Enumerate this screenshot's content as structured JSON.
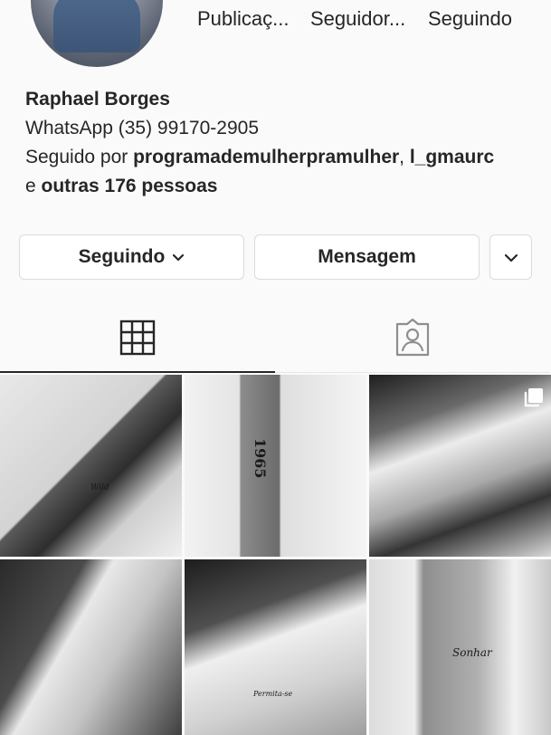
{
  "profile": {
    "stats": [
      {
        "label": "Publicaç..."
      },
      {
        "label": "Seguidor..."
      },
      {
        "label": "Seguindo"
      }
    ],
    "name": "Raphael Borges",
    "bio_line": "WhatsApp (35) 99170-2905",
    "followed_by_prefix": "Seguido por ",
    "followed_by_user1": "programademulherpramulher",
    "followed_by_sep": ", ",
    "followed_by_user2": "l_gmaurc",
    "followed_by_and": "e ",
    "followed_by_others": "outras 176 pessoas"
  },
  "actions": {
    "following_label": "Seguindo",
    "message_label": "Mensagem"
  },
  "tabs": [
    {
      "icon": "grid-icon"
    },
    {
      "icon": "tagged-user-icon"
    }
  ],
  "posts": [
    {
      "tattoo": "Wild"
    },
    {
      "tattoo": "1965"
    },
    {
      "tattoo": ""
    },
    {
      "tattoo": ""
    },
    {
      "tattoo": "Permita-se"
    },
    {
      "tattoo": "Sonhar"
    }
  ]
}
